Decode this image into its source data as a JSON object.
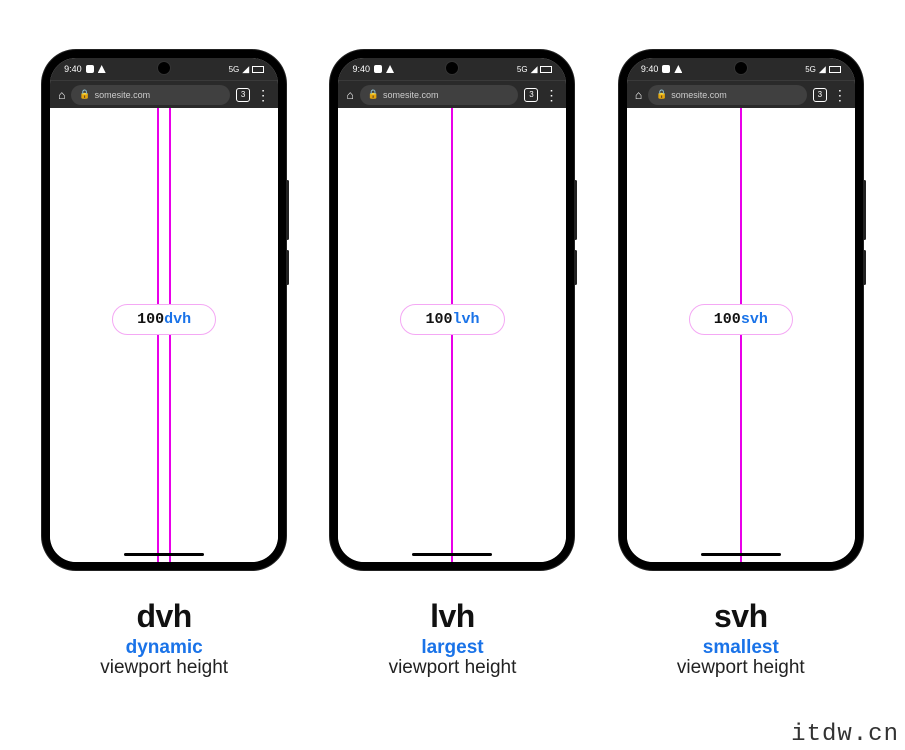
{
  "status": {
    "time": "9:40",
    "network_label": "5G",
    "tab_count": "3"
  },
  "url": {
    "text": "somesite.com"
  },
  "pill_value": "100",
  "phones": [
    {
      "unit": "dvh",
      "lines": "double",
      "title": "dvh",
      "sub_blue": "dynamic",
      "sub_text": "viewport height"
    },
    {
      "unit": "lvh",
      "lines": "single",
      "title": "lvh",
      "sub_blue": "largest",
      "sub_text": "viewport height"
    },
    {
      "unit": "svh",
      "lines": "single",
      "title": "svh",
      "sub_blue": "smallest",
      "sub_text": "viewport height"
    }
  ],
  "watermark": "itdw.cn"
}
